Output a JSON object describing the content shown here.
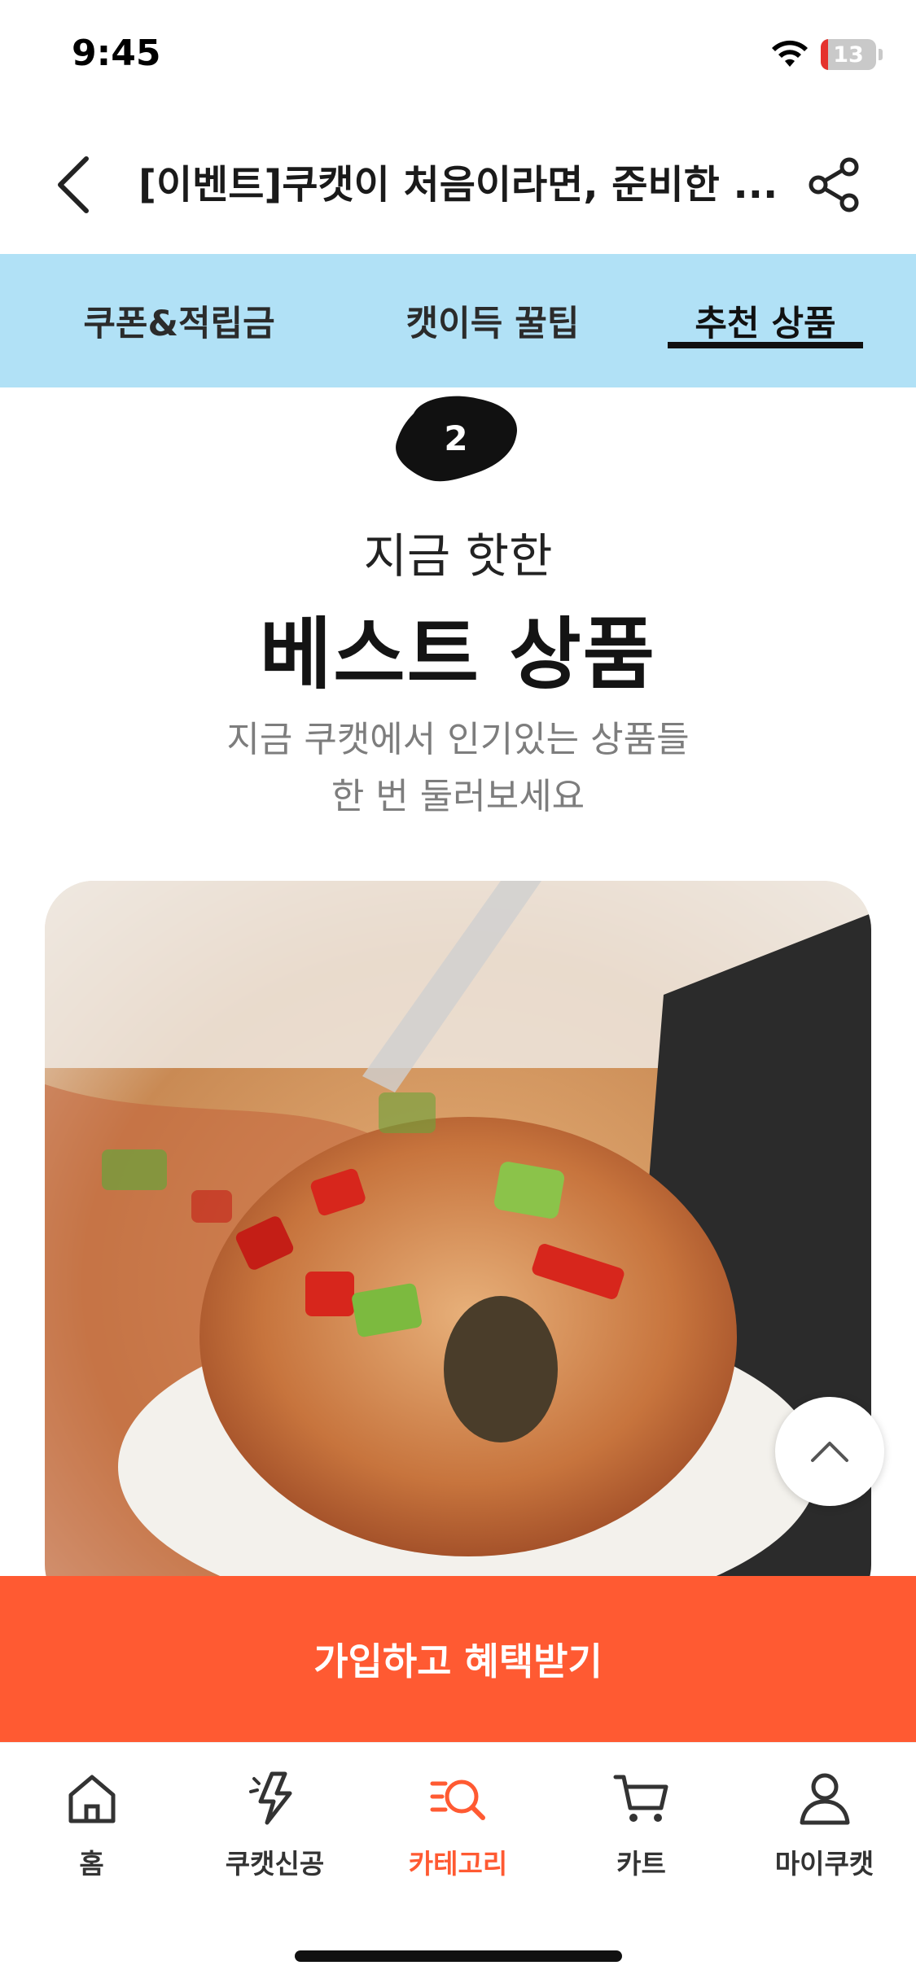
{
  "status_bar": {
    "time": "9:45",
    "battery": "13",
    "battery_level": 0.13
  },
  "header": {
    "title": "[이벤트]쿠캣이 처음이라면, 준비한 ...",
    "back_icon": "chevron-left-icon",
    "share_icon": "share-icon"
  },
  "tabs": [
    {
      "label": "쿠폰&적립금",
      "active": false
    },
    {
      "label": "캣이득 꿀팁",
      "active": false
    },
    {
      "label": "추천 상품",
      "active": true
    }
  ],
  "section": {
    "step_number": "2",
    "subtitle": "지금 핫한",
    "title": "베스트 상품",
    "description_line1": "지금 쿠캣에서 인기있는 상품들",
    "description_line2": "한 번 둘러보세요"
  },
  "cta": {
    "label": "가입하고 혜택받기"
  },
  "bottom_nav": [
    {
      "label": "홈",
      "icon": "home-icon",
      "active": false
    },
    {
      "label": "쿠캣신공",
      "icon": "lightning-icon",
      "active": false
    },
    {
      "label": "카테고리",
      "icon": "category-search-icon",
      "active": true
    },
    {
      "label": "카트",
      "icon": "cart-icon",
      "active": false
    },
    {
      "label": "마이쿠캣",
      "icon": "person-icon",
      "active": false
    }
  ],
  "colors": {
    "accent": "#ff5a32",
    "tab_bg": "#b1e1f6",
    "text_dark": "#141414",
    "text_muted": "#7d7d7d"
  }
}
